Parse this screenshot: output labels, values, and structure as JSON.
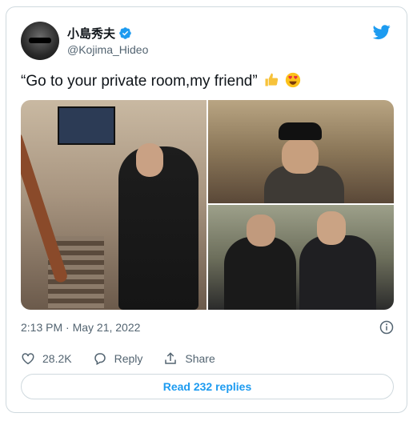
{
  "tweet": {
    "author_name": "小島秀夫",
    "handle": "@Kojima_Hideo",
    "text": "“Go to your private room,my friend”",
    "emojis": [
      "thumbs-up-emoji",
      "heart-eyes-emoji"
    ],
    "timestamp": "2:13 PM · May 21, 2022",
    "likes": "28.2K",
    "reply_label": "Reply",
    "share_label": "Share",
    "read_replies_label": "Read 232 replies"
  },
  "colors": {
    "twitter_blue": "#1d9bf0",
    "secondary_text": "#536471",
    "border": "#cfd9de"
  },
  "icons": {
    "logo": "twitter-bird-icon",
    "verified": "verified-badge-icon",
    "info": "info-icon",
    "like": "heart-icon",
    "reply": "reply-bubble-icon",
    "share": "share-upload-icon"
  }
}
